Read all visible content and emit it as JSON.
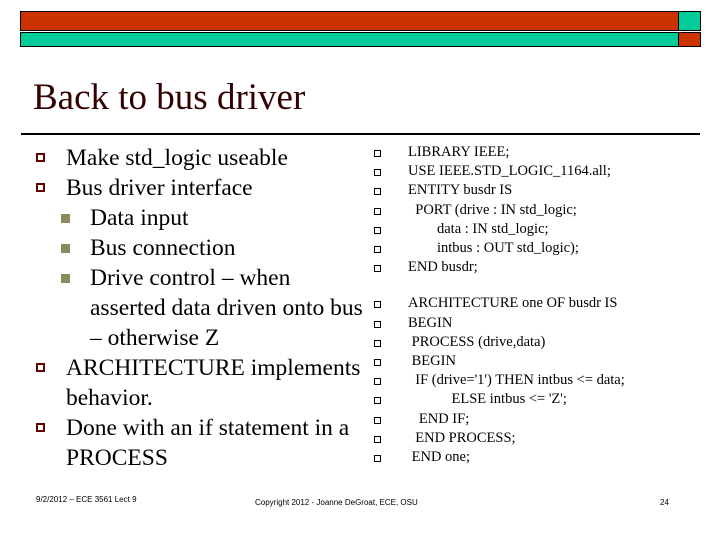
{
  "theme": {
    "red": "#cc3300",
    "teal": "#00cc99",
    "title_color": "#330000",
    "bullet_level1_color": "#660000",
    "bullet_level2_color": "#8a8a5c",
    "border_color": "#000000"
  },
  "header": {
    "bar_top_main_icon": "red-band",
    "bar_top_cap_icon": "teal-square",
    "bar_bottom_main_icon": "teal-band",
    "bar_bottom_cap_icon": "red-square"
  },
  "title": "Back to bus driver",
  "left_column": {
    "items": [
      {
        "level": 1,
        "text": "Make std_logic useable"
      },
      {
        "level": 1,
        "text": "Bus driver interface"
      },
      {
        "level": 2,
        "text": "Data input"
      },
      {
        "level": 2,
        "text": "Bus connection"
      },
      {
        "level": 2,
        "text": "Drive control – when asserted data driven onto bus – otherwise Z"
      },
      {
        "level": 1,
        "text": "ARCHITECTURE implements behavior."
      },
      {
        "level": 1,
        "text": "Done with an if statement in a PROCESS"
      }
    ]
  },
  "right_column": {
    "block1": [
      "LIBRARY IEEE;",
      "USE IEEE.STD_LOGIC_1164.all;",
      "ENTITY busdr IS",
      "  PORT (drive : IN std_logic;",
      "        data : IN std_logic;",
      "        intbus : OUT std_logic);",
      "END busdr;"
    ],
    "block2": [
      "ARCHITECTURE one OF busdr IS",
      "BEGIN",
      " PROCESS (drive,data)",
      " BEGIN",
      "  IF (drive='1') THEN intbus <= data;",
      "            ELSE intbus <= 'Z';",
      "   END IF;",
      "  END PROCESS;",
      " END one;"
    ]
  },
  "footer": {
    "left": "9/2/2012 – ECE 3561 Lect 9",
    "center": "Copyright 2012 - Joanne DeGroat, ECE, OSU",
    "page": "24"
  }
}
